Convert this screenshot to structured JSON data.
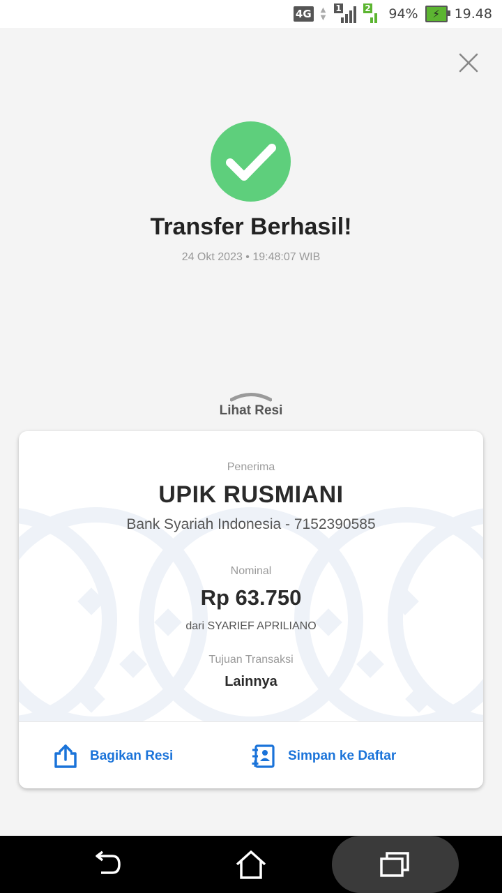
{
  "status_bar": {
    "network": "4G",
    "sim1": "1",
    "sim2": "2",
    "battery_percent": "94%",
    "time": "19.48"
  },
  "header": {
    "title": "Transfer Berhasil!",
    "datetime": "24 Okt 2023 • 19:48:07 WIB",
    "close_icon": "close-icon"
  },
  "receipt_toggle": {
    "label": "Lihat Resi"
  },
  "receipt": {
    "recipient_label": "Penerima",
    "recipient_name": "UPIK RUSMIANI",
    "bank_line": "Bank Syariah Indonesia - 7152390585",
    "amount_label": "Nominal",
    "amount": "Rp 63.750",
    "from_line": "dari SYARIEF APRILIANO",
    "purpose_label": "Tujuan Transaksi",
    "purpose": "Lainnya"
  },
  "actions": {
    "share_label": "Bagikan Resi",
    "save_label": "Simpan ke Daftar"
  },
  "colors": {
    "success_green": "#5ecf7c",
    "action_blue": "#1a73d9",
    "battery_green": "#5cb531"
  }
}
